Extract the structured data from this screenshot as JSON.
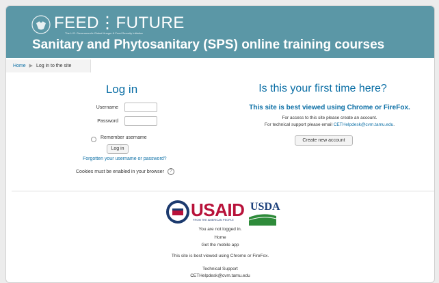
{
  "header": {
    "brand": "FEED⋮FUTURE",
    "brand_sub": "The U.S. Government's Global Hunger & Food Security Initiative",
    "site_title": "Sanitary and Phytosanitary (SPS) online training courses"
  },
  "breadcrumb": {
    "home": "Home",
    "current": "Log in to the site"
  },
  "login": {
    "heading": "Log in",
    "username_label": "Username",
    "password_label": "Password",
    "username_value": "",
    "password_value": "",
    "remember_label": "Remember username",
    "login_button": "Log in",
    "forgot_link": "Forgotten your username or password?",
    "cookies_text": "Cookies must be enabled in your browser",
    "help_icon": "?"
  },
  "signup": {
    "heading": "Is this your first time here?",
    "best_view": "This site is best viewed using Chrome or FireFox.",
    "info_line1": "For access to this site please create an account.",
    "info_line2_prefix": "For technical support please email ",
    "info_line2_email": "CETHelpdesk@cvm.tamu.edu",
    "info_line2_suffix": ".",
    "create_button": "Create new account"
  },
  "footer": {
    "usaid": "USAID",
    "usaid_sub": "FROM THE AMERICAN PEOPLE",
    "usda": "USDA",
    "not_logged": "You are not logged in.",
    "home_link": "Home",
    "mobile_app_link": "Get the mobile app",
    "best_view": "This site is best viewed using Chrome or FireFox.",
    "tech_support": "Technical Support",
    "email_link": "CETHelpdesk@cvm.tamu.edu"
  },
  "colors": {
    "banner": "#5b97a6",
    "link": "#0a6ea5",
    "usaid_red": "#b8123a",
    "usda_blue": "#1b3f7a",
    "usda_green": "#2e8b3a"
  }
}
